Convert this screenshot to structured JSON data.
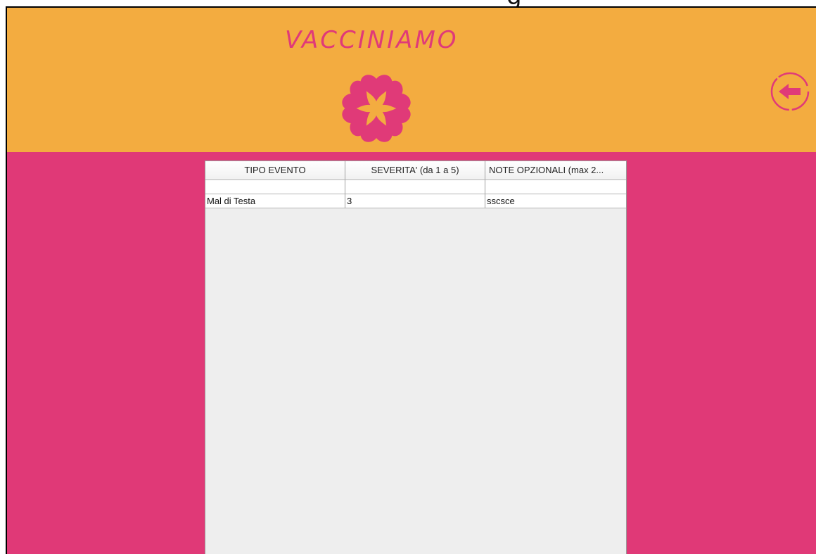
{
  "top_fragment": "g",
  "header": {
    "title": "VACCINIAMO",
    "logo_icon": "flower-icon",
    "back_icon": "back-arrow-icon",
    "colors": {
      "header_bg": "#f3ac40",
      "accent": "#e03a78",
      "content_bg": "#e03977"
    }
  },
  "table": {
    "columns": [
      "TIPO EVENTO",
      "SEVERITA' (da 1 a 5)",
      "NOTE OPZIONALI (max 2..."
    ],
    "rows": [
      [
        "",
        "",
        ""
      ],
      [
        "Mal di Testa",
        "3",
        "sscsce"
      ]
    ]
  }
}
